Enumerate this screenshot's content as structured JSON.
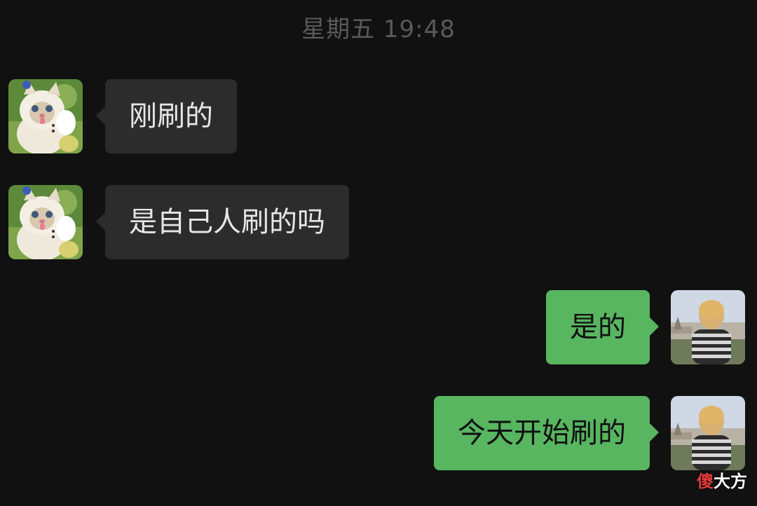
{
  "timestamp": "星期五 19:48",
  "messages": [
    {
      "direction": "in",
      "text": "刚刷的",
      "avatar_icon": "cat-avatar-icon"
    },
    {
      "direction": "in",
      "text": "是自己人刷的吗",
      "avatar_icon": "cat-avatar-icon"
    },
    {
      "direction": "out",
      "text": "是的",
      "avatar_icon": "child-avatar-icon"
    },
    {
      "direction": "out",
      "text": "今天开始刷的",
      "avatar_icon": "child-avatar-icon"
    }
  ],
  "watermark": {
    "red_part": "傻",
    "white_part": "大方"
  },
  "colors": {
    "background": "#111111",
    "incoming_bubble": "#2c2c2c",
    "outgoing_bubble": "#58b560",
    "timestamp_text": "#5a5a5a"
  }
}
